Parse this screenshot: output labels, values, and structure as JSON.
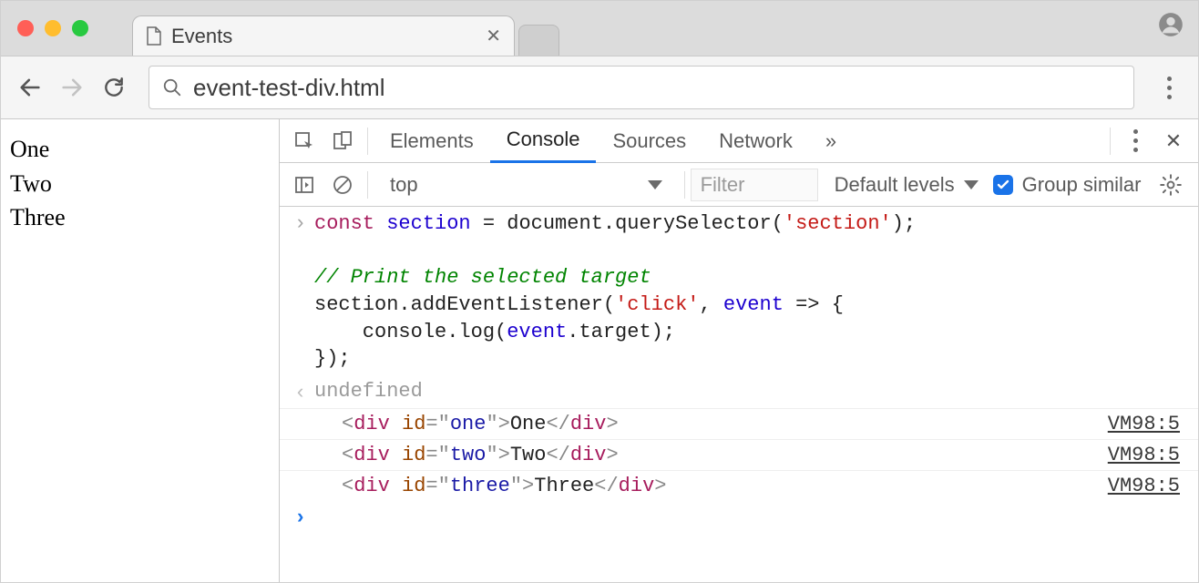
{
  "browser": {
    "tab_title": "Events",
    "url": "event-test-div.html"
  },
  "page": {
    "lines": [
      "One",
      "Two",
      "Three"
    ]
  },
  "devtools": {
    "tabs": {
      "elements": "Elements",
      "console": "Console",
      "sources": "Sources",
      "network": "Network"
    },
    "overflow": "»",
    "toolbar": {
      "context": "top",
      "filter_placeholder": "Filter",
      "levels": "Default levels",
      "group_similar": "Group similar"
    },
    "console": {
      "code": "const section = document.querySelector('section');\n\n// Print the selected target\nsection.addEventListener('click', event => {\n    console.log(event.target);\n});",
      "tokens": {
        "const": "const",
        "sectionVar": "section",
        "eq": " = ",
        "documentQS": "document.querySelector(",
        "sectionStr": "'section'",
        "close1": ");",
        "comment": "// Print the selected target",
        "sectionDot": "section.addEventListener(",
        "clickStr": "'click'",
        "comma": ", ",
        "eventVar": "event",
        "arrow": " => {",
        "logPre": "    console.log(",
        "eventTarget": "event",
        "dotTarget": ".target);",
        "closeFn": "});"
      },
      "return_value": "undefined",
      "entries": [
        {
          "tag": "div",
          "attr": "id",
          "val": "one",
          "text": "One",
          "source": "VM98:5"
        },
        {
          "tag": "div",
          "attr": "id",
          "val": "two",
          "text": "Two",
          "source": "VM98:5"
        },
        {
          "tag": "div",
          "attr": "id",
          "val": "three",
          "text": "Three",
          "source": "VM98:5"
        }
      ]
    }
  }
}
